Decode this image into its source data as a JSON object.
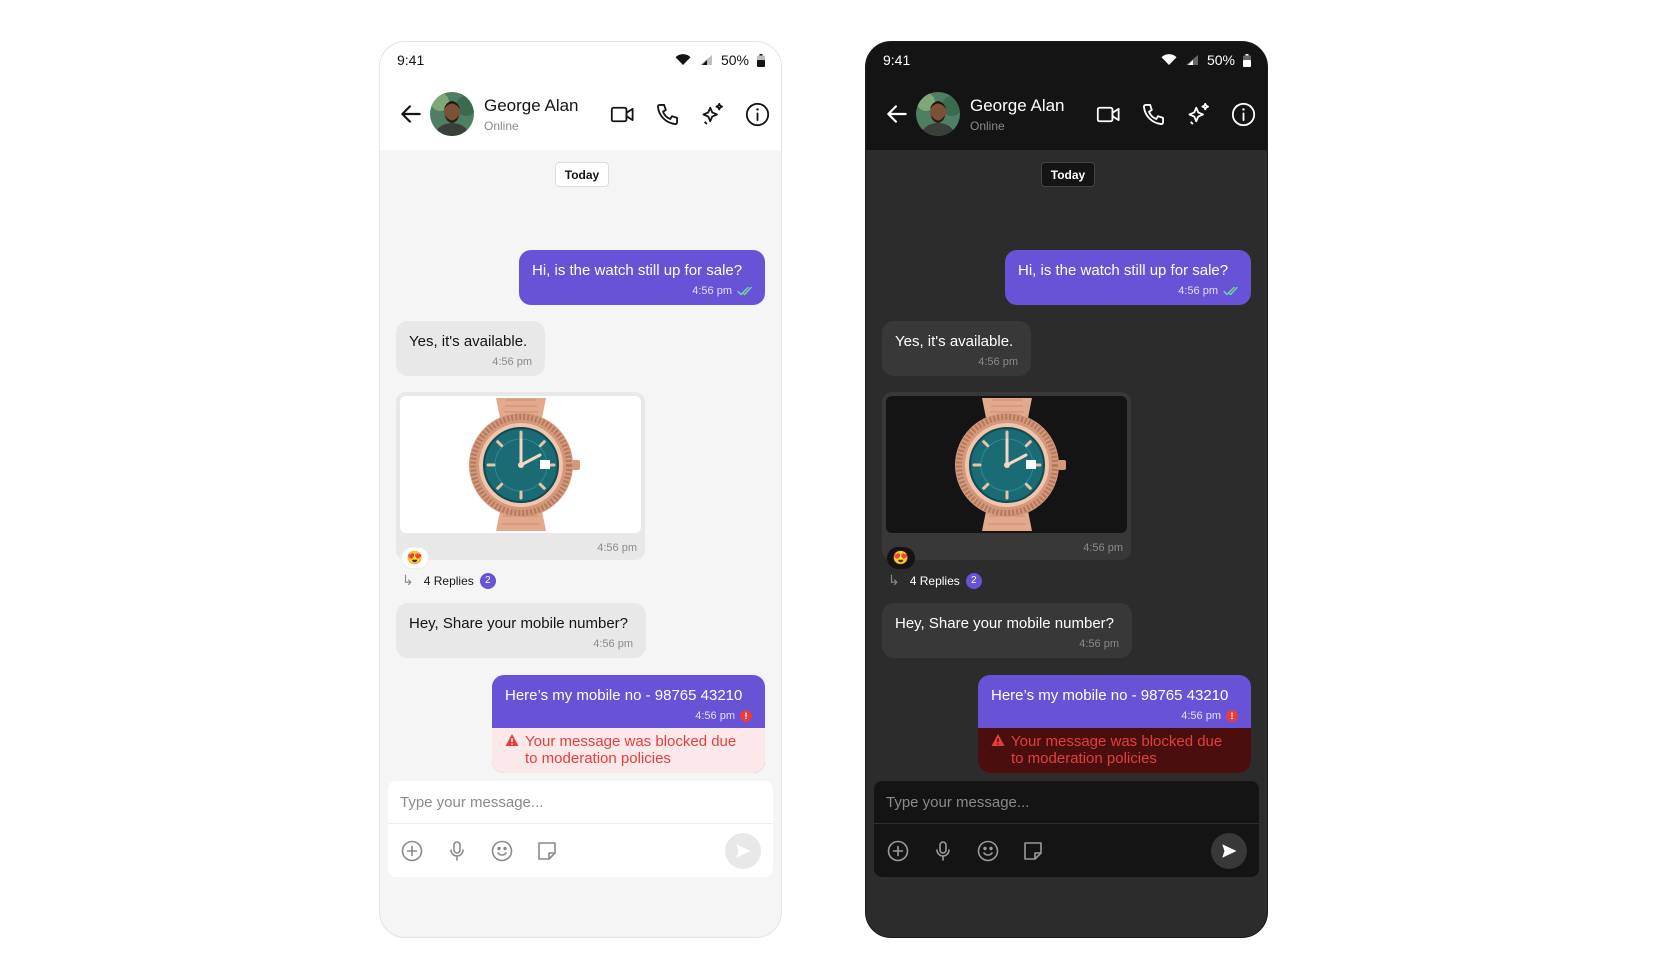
{
  "status": {
    "time": "9:41",
    "battery": "50%"
  },
  "contact": {
    "name": "George Alan",
    "status": "Online"
  },
  "date_chip": "Today",
  "messages": {
    "m1": {
      "text": "Hi, is the watch still up for sale?",
      "time": "4:56 pm"
    },
    "m2": {
      "text": "Yes, it's available.",
      "time": "4:56 pm"
    },
    "m3": {
      "time": "4:56 pm",
      "reaction": "😍",
      "replies_label": "4 Replies",
      "replies_count": "2"
    },
    "m4": {
      "text": "Hey, Share your mobile number?",
      "time": "4:56 pm"
    },
    "m5": {
      "text": "Here’s my mobile no - 98765 43210",
      "time": "4:56 pm",
      "error_mark": "!",
      "blocked": "Your message was blocked due to moderation policies"
    }
  },
  "composer": {
    "placeholder": "Type your message..."
  },
  "icons": {
    "header": [
      "back-arrow-icon",
      "video-call-icon",
      "voice-call-icon",
      "ai-sparkle-icon",
      "info-icon"
    ],
    "composer": [
      "add-circle-icon",
      "microphone-icon",
      "emoji-icon",
      "sticker-icon",
      "send-icon"
    ]
  },
  "colors": {
    "accent": "#6852d6",
    "error": "#e53e3e",
    "light_bg": "#f5f5f5",
    "dark_bg": "#2c2c2c"
  }
}
